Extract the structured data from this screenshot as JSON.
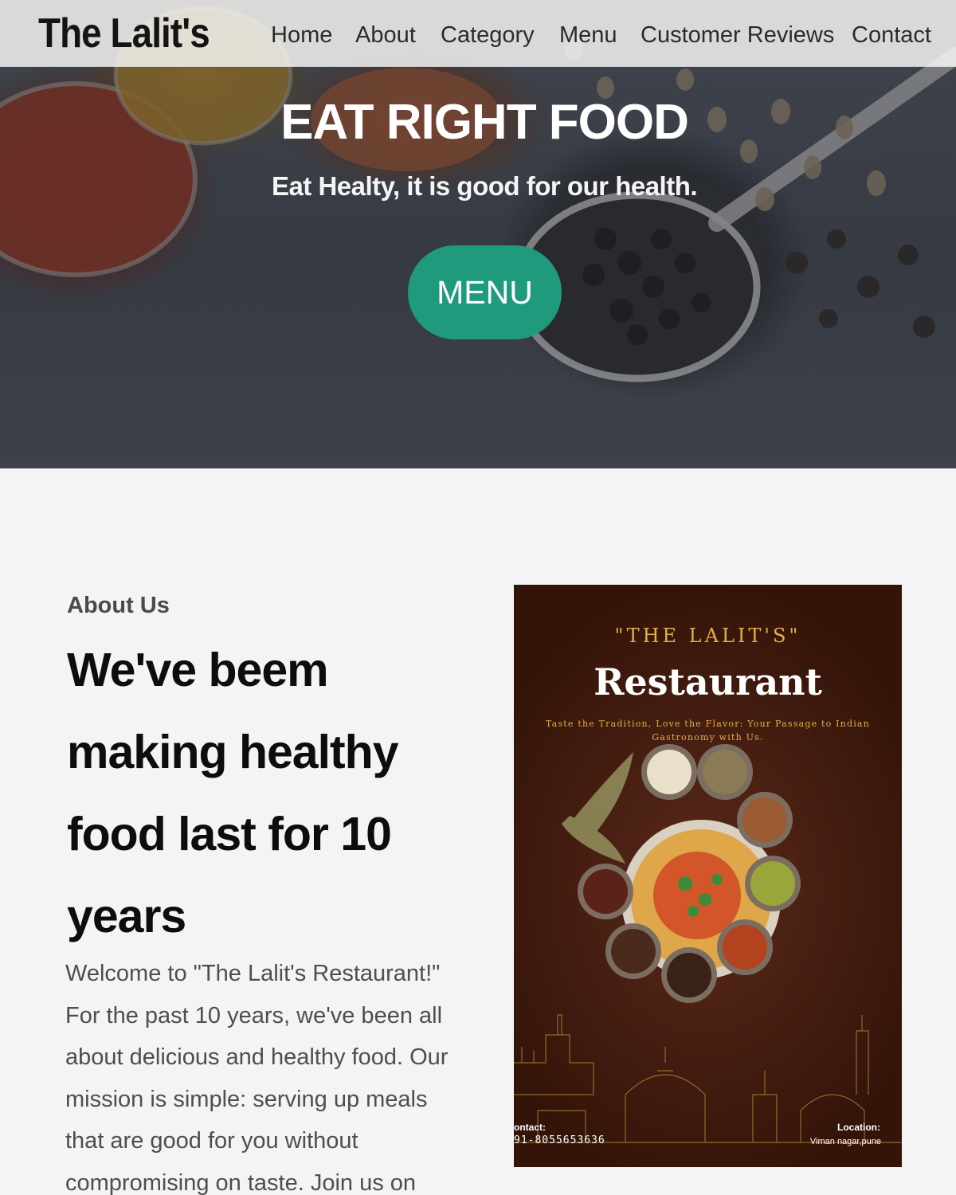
{
  "site": {
    "brand": "The Lalit's"
  },
  "nav": {
    "items": [
      {
        "label": "Home"
      },
      {
        "label": "About"
      },
      {
        "label": "Category"
      },
      {
        "label": "Menu"
      },
      {
        "label": "Customer Reviews"
      },
      {
        "label": "Contact"
      }
    ]
  },
  "hero": {
    "title": "EAT RIGHT FOOD",
    "subtitle": "Eat Healty, it is good for our health.",
    "button_label": "MENU",
    "button_color": "#1f9a7d"
  },
  "about": {
    "kicker": "About Us",
    "heading": "We've beem making healthy food last for 10 years",
    "body": "Welcome to \"The Lalit's Restaurant!\" For the past 10 years, we've been all about delicious and healthy food. Our mission is simple: serving up meals that are good for you without compromising on taste. Join us on this"
  },
  "poster": {
    "top_text": "\"THE LALIT'S\"",
    "name": "Restaurant",
    "tagline": "Taste the Tradition, Love the Flavor: Your Passage to Indian Gastronomy with Us.",
    "contact_label": "ontact:",
    "contact_value": "91-8055653636",
    "location_label": "Location:",
    "location_value": "Viman nagar,pune"
  }
}
